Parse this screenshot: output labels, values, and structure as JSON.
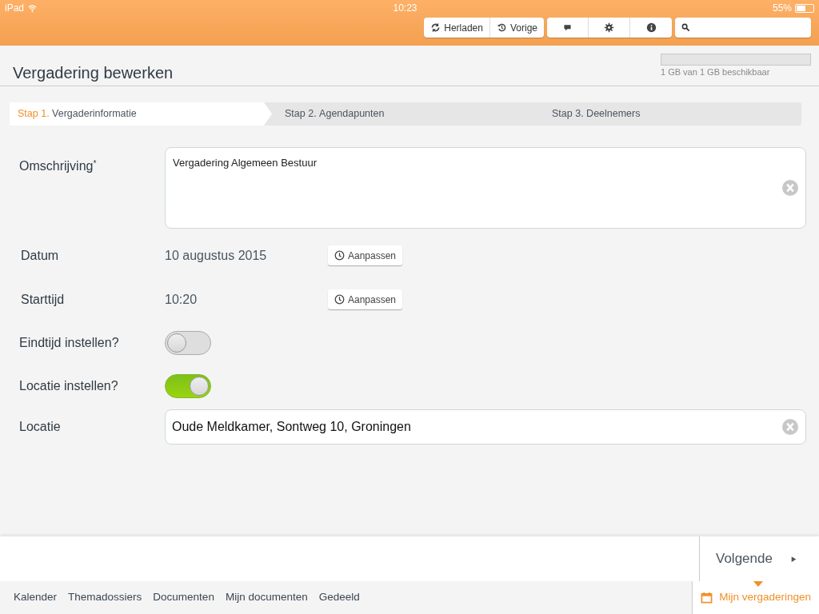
{
  "status_bar": {
    "device": "iPad",
    "time": "10:23",
    "battery": "55%"
  },
  "toolbar": {
    "history_buttons": [
      {
        "label": "Herladen",
        "kind": "reload"
      },
      {
        "label": "Vorige",
        "kind": "history"
      }
    ],
    "icon_buttons": [
      {
        "kind": "comment"
      },
      {
        "kind": "settings"
      },
      {
        "kind": "info"
      }
    ]
  },
  "page": {
    "title": "Vergadering bewerken",
    "storage": {
      "level": 0,
      "text": "1 GB van 1 GB beschikbaar"
    }
  },
  "steps": [
    {
      "number": "Stap 1.",
      "label": "Vergaderinformatie",
      "selected": true
    },
    {
      "number": "Stap 2.",
      "label": "Agendapunten",
      "selected": false
    },
    {
      "number": "Stap 3.",
      "label": "Deelnemers",
      "selected": false
    }
  ],
  "fields": [
    {
      "kind": "textarea",
      "label": "Omschrijving",
      "required_mark": "*",
      "value": "Vergadering Algemeen Bestuur"
    },
    {
      "kind": "picker",
      "label": "Datum",
      "value": "10 augustus 2015",
      "button": "Aanpassen"
    },
    {
      "kind": "picker",
      "label": "Starttijd",
      "value": "10:20",
      "button": "Aanpassen"
    },
    {
      "kind": "toggle",
      "label": "Eindtijd instellen?",
      "on": false
    },
    {
      "kind": "toggle",
      "label": "Locatie instellen?",
      "on": true
    },
    {
      "kind": "input",
      "label": "Locatie",
      "value": "Oude Meldkamer, Sontweg 10, Groningen"
    }
  ],
  "next_button": {
    "label": "Volgende"
  },
  "bottom_nav": [
    {
      "label": "Kalender",
      "selected": false
    },
    {
      "label": "Themadossiers",
      "selected": false
    },
    {
      "label": "Documenten",
      "selected": false
    },
    {
      "label": "Mijn documenten",
      "selected": false
    },
    {
      "label": "Gedeeld",
      "selected": false
    },
    {
      "label": "Mijn vergaderingen",
      "selected": true
    }
  ]
}
